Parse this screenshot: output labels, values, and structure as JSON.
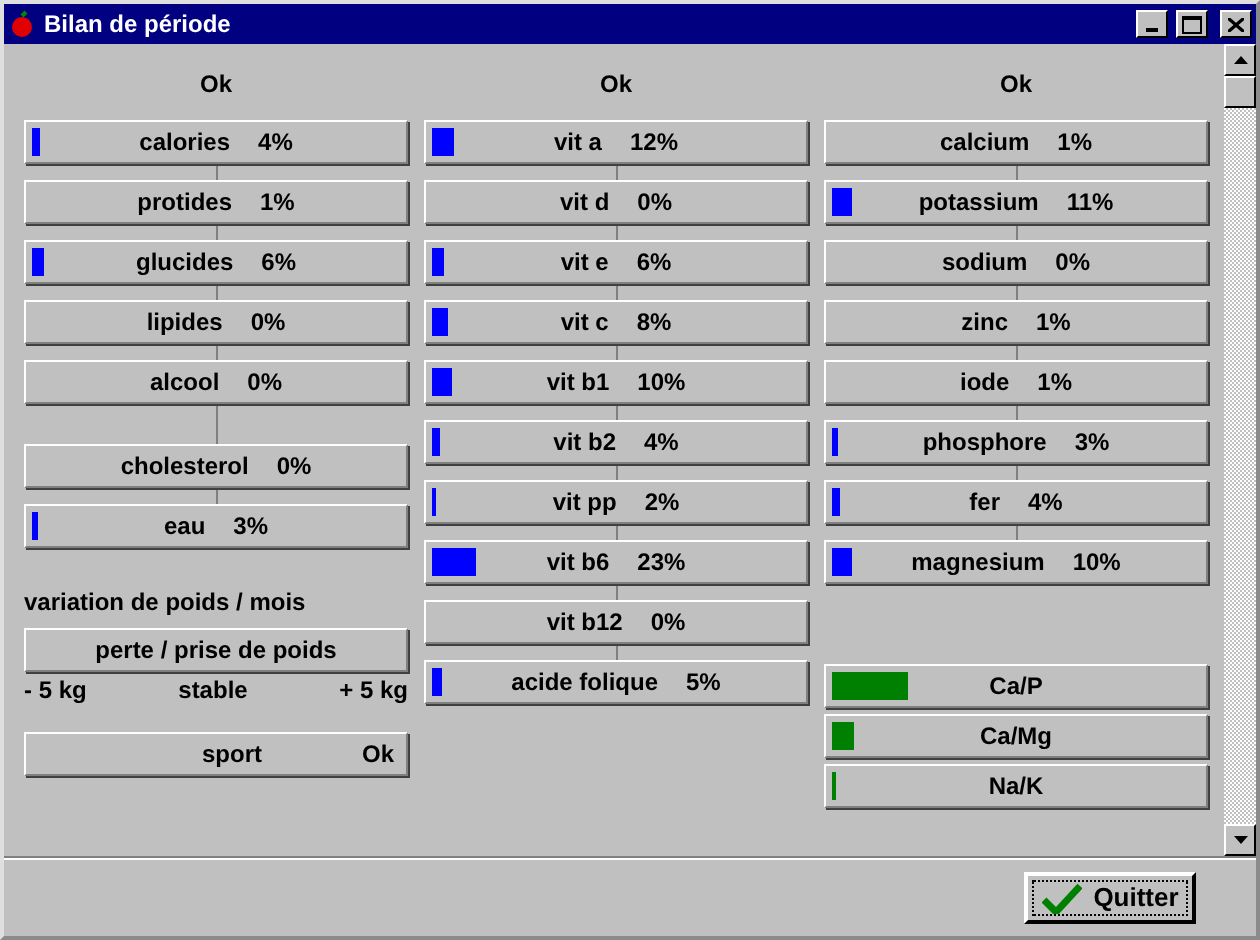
{
  "window": {
    "title": "Bilan de période"
  },
  "columns": [
    {
      "status": "Ok",
      "groups": [
        [
          {
            "label": "calories",
            "value": "4%",
            "level": 0.02
          },
          {
            "label": "protides",
            "value": "1%"
          },
          {
            "label": "glucides",
            "value": "6%",
            "level": 0.03
          },
          {
            "label": "lipides",
            "value": "0%"
          },
          {
            "label": "alcool",
            "value": "0%"
          }
        ],
        [
          {
            "label": "cholesterol",
            "value": "0%"
          },
          {
            "label": "eau",
            "value": "3%",
            "level": 0.015
          }
        ]
      ],
      "weight": {
        "title": "variation de poids / mois",
        "button": "perte / prise de poids",
        "scale": [
          "- 5 kg",
          "stable",
          "+ 5 kg"
        ]
      },
      "sport": {
        "label": "sport",
        "status": "Ok"
      }
    },
    {
      "status": "Ok",
      "groups": [
        [
          {
            "label": "vit a",
            "value": "12%",
            "level": 0.06
          },
          {
            "label": "vit d",
            "value": "0%"
          },
          {
            "label": "vit e",
            "value": "6%",
            "level": 0.03
          },
          {
            "label": "vit c",
            "value": "8%",
            "level": 0.04
          },
          {
            "label": "vit b1",
            "value": "10%",
            "level": 0.05
          },
          {
            "label": "vit b2",
            "value": "4%",
            "level": 0.02
          },
          {
            "label": "vit pp",
            "value": "2%",
            "level": 0.01
          },
          {
            "label": "vit b6",
            "value": "23%",
            "level": 0.115
          },
          {
            "label": "vit b12",
            "value": "0%"
          },
          {
            "label": "acide folique",
            "value": "5%",
            "level": 0.025
          }
        ]
      ]
    },
    {
      "status": "Ok",
      "groups": [
        [
          {
            "label": "calcium",
            "value": "1%"
          },
          {
            "label": "potassium",
            "value": "11%",
            "level": 0.055
          },
          {
            "label": "sodium",
            "value": "0%"
          },
          {
            "label": "zinc",
            "value": "1%"
          },
          {
            "label": "iode",
            "value": "1%"
          },
          {
            "label": "phosphore",
            "value": "3%",
            "level": 0.015
          },
          {
            "label": "fer",
            "value": "4%",
            "level": 0.02
          },
          {
            "label": "magnesium",
            "value": "10%",
            "level": 0.05
          }
        ]
      ],
      "ratios": [
        {
          "label": "Ca/P",
          "level": 0.2
        },
        {
          "label": "Ca/Mg",
          "level": 0.06
        },
        {
          "label": "Na/K",
          "level": 0.008
        }
      ]
    }
  ],
  "buttons": [
    "Quitter"
  ]
}
